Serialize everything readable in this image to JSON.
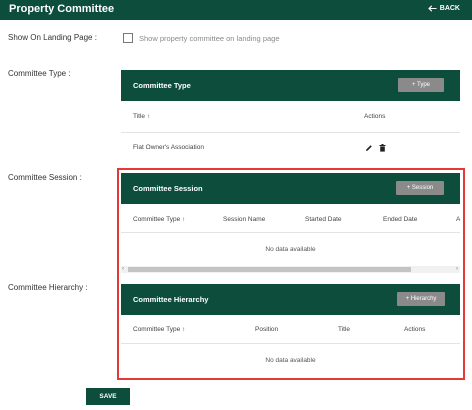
{
  "header": {
    "title": "Property Committee",
    "back_label": "BACK"
  },
  "labels": {
    "show_on_landing": "Show On Landing Page :",
    "committee_type": "Committee Type :",
    "committee_session": "Committee Session :",
    "committee_hierarchy": "Committee Hierarchy :"
  },
  "landing_checkbox": {
    "label": "Show property committee on landing page",
    "checked": false
  },
  "type_card": {
    "title": "Committee Type",
    "add_button": "+ Type",
    "columns": [
      "Title",
      "Actions"
    ],
    "rows": [
      {
        "title": "Flat Owner's Association"
      }
    ]
  },
  "session_card": {
    "title": "Committee Session",
    "add_button": "+ Session",
    "columns": [
      "Committee Type",
      "Session Name",
      "Started Date",
      "Ended Date",
      "A"
    ],
    "empty_text": "No data available"
  },
  "hierarchy_card": {
    "title": "Committee Hierarchy",
    "add_button": "+ Hierarchy",
    "columns": [
      "Committee Type",
      "Position",
      "Title",
      "Actions"
    ],
    "empty_text": "No data available"
  },
  "save_label": "SAVE",
  "colors": {
    "primary": "#0d4d3c",
    "button_gray": "#8a8a8a",
    "highlight": "#e53935"
  }
}
